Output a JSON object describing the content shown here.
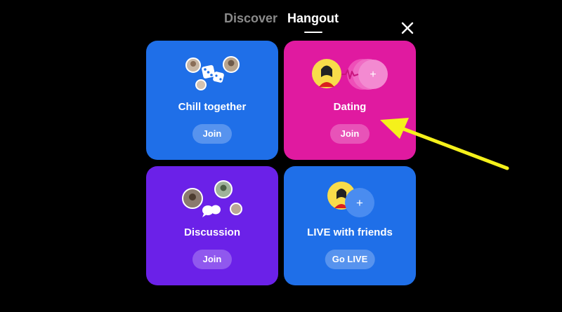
{
  "tabs": {
    "discover": "Discover",
    "hangout": "Hangout"
  },
  "cards": [
    {
      "title": "Chill together",
      "button": "Join",
      "color": "#1f6fe8"
    },
    {
      "title": "Dating",
      "button": "Join",
      "color": "#e01aa0"
    },
    {
      "title": "Discussion",
      "button": "Join",
      "color": "#6b21e8"
    },
    {
      "title": "LIVE with friends",
      "button": "Go LIVE",
      "color": "#1f6fe8"
    }
  ],
  "annotation": {
    "arrow_color": "#f5f11b"
  }
}
